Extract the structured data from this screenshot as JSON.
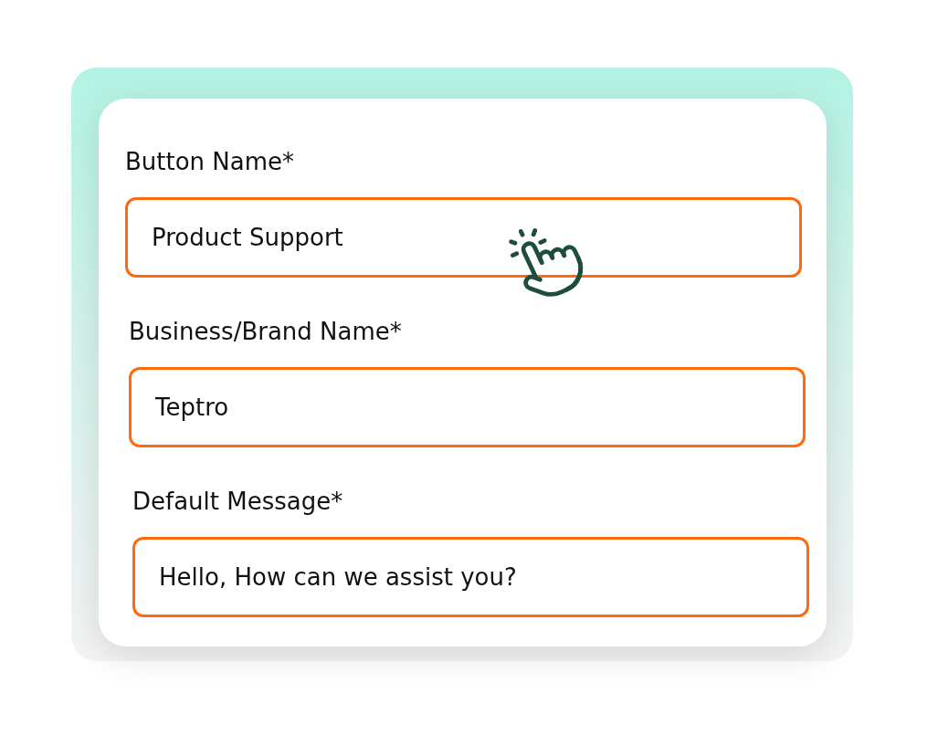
{
  "fields": [
    {
      "label": "Button Name*",
      "value": "Product Support"
    },
    {
      "label": "Business/Brand Name*",
      "value": "Teptro"
    },
    {
      "label": "Default Message*",
      "value": "Hello, How can we assist you?"
    }
  ]
}
